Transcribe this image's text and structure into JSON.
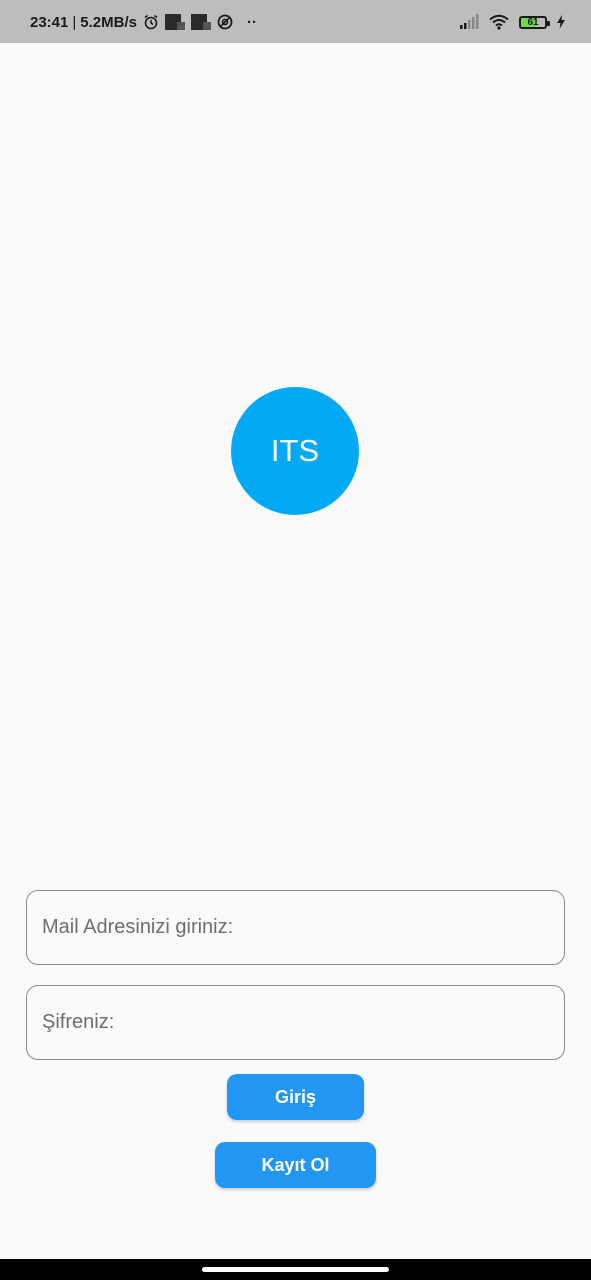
{
  "status_bar": {
    "time": "23:41",
    "separator": "|",
    "network_speed": "5.2MB/s",
    "more_notifications": "··",
    "battery_level": "61",
    "icons_left": [
      "alarm-icon",
      "notification-icon",
      "notification-icon",
      "sync-icon"
    ],
    "icons_right": [
      "signal-icon",
      "wifi-icon",
      "battery-icon",
      "charging-icon"
    ]
  },
  "logo": {
    "text": "ITS",
    "color": "#03a9f4"
  },
  "form": {
    "email_placeholder": "Mail Adresinizi giriniz:",
    "email_value": "",
    "password_placeholder": "Şifreniz:",
    "password_value": ""
  },
  "buttons": {
    "login_label": "Giriş",
    "register_label": "Kayıt Ol",
    "color": "#2196f3"
  }
}
